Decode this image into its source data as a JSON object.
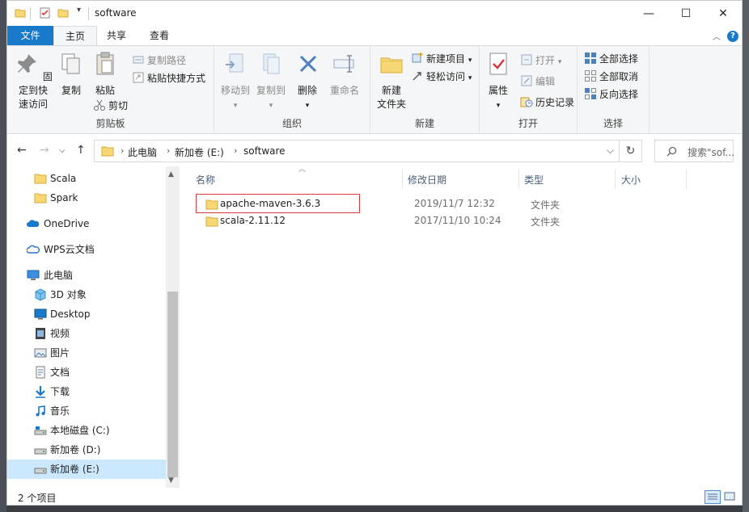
{
  "window": {
    "title": "software",
    "controls": {
      "minimize": "—",
      "maximize": "☐",
      "close": "✕"
    }
  },
  "tabs": [
    {
      "label": "文件"
    },
    {
      "label": "主页"
    },
    {
      "label": "共享"
    },
    {
      "label": "查看"
    }
  ],
  "ribbon": {
    "clipboard": {
      "label": "剪贴板",
      "pin": "固定到快\n速访问",
      "copy": "复制",
      "paste": "粘贴",
      "copy_path": "复制路径",
      "paste_shortcut": "粘贴快捷方式",
      "cut": "剪切"
    },
    "organize": {
      "label": "组织",
      "move_to": "移动到",
      "copy_to": "复制到",
      "delete": "删除",
      "rename": "重命名"
    },
    "new": {
      "label": "新建",
      "new_folder": "新建\n文件夹",
      "new_item": "新建项目",
      "easy_access": "轻松访问"
    },
    "open": {
      "label": "打开",
      "properties": "属性",
      "open": "打开",
      "edit": "编辑",
      "history": "历史记录"
    },
    "select": {
      "label": "选择",
      "select_all": "全部选择",
      "select_none": "全部取消",
      "invert": "反向选择"
    }
  },
  "address": {
    "crumbs": [
      "此电脑",
      "新加卷 (E:)",
      "software"
    ],
    "search_placeholder": "搜索\"sof..."
  },
  "nav": {
    "items": [
      {
        "label": "Scala",
        "icon": "folder-icon"
      },
      {
        "label": "Spark",
        "icon": "folder-icon"
      },
      {
        "label": "OneDrive",
        "icon": "cloud-icon"
      },
      {
        "label": "WPS云文档",
        "icon": "cloud-icon"
      },
      {
        "label": "此电脑",
        "icon": "computer-icon"
      },
      {
        "label": "3D 对象",
        "icon": "cube-icon"
      },
      {
        "label": "Desktop",
        "icon": "desktop-icon"
      },
      {
        "label": "视频",
        "icon": "video-icon"
      },
      {
        "label": "图片",
        "icon": "picture-icon"
      },
      {
        "label": "文档",
        "icon": "document-icon"
      },
      {
        "label": "下载",
        "icon": "download-icon"
      },
      {
        "label": "音乐",
        "icon": "music-icon"
      },
      {
        "label": "本地磁盘 (C:)",
        "icon": "drive-icon"
      },
      {
        "label": "新加卷 (D:)",
        "icon": "drive-icon"
      },
      {
        "label": "新加卷 (E:)",
        "icon": "drive-icon"
      }
    ]
  },
  "columns": {
    "name": "名称",
    "modified": "修改日期",
    "type": "类型",
    "size": "大小"
  },
  "files": [
    {
      "name": "apache-maven-3.6.3",
      "modified": "2019/11/7 12:32",
      "type": "文件夹",
      "size": ""
    },
    {
      "name": "scala-2.11.12",
      "modified": "2017/11/10 10:24",
      "type": "文件夹",
      "size": ""
    }
  ],
  "status": {
    "count": "2 个项目"
  },
  "colors": {
    "accent": "#1979ca",
    "selection": "#cce8ff",
    "highlight": "#d43b3b",
    "folder": "#f8d775"
  }
}
